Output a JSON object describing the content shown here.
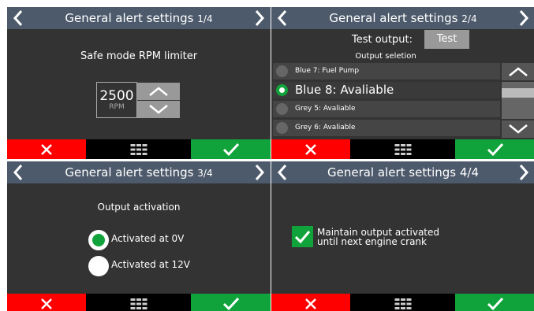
{
  "colors": {
    "background": "#333333",
    "title_bar": "#4d5a6b",
    "cancel": "#ff0000",
    "confirm": "#11a33b",
    "control_gray": "#999999"
  },
  "screens": [
    {
      "title": "General alert settings",
      "page": "1/4",
      "label": "Safe mode RPM limiter",
      "rpm_value": "2500",
      "rpm_unit": "RPM"
    },
    {
      "title": "General alert settings",
      "page": "2/4",
      "test_label": "Test output:",
      "test_button": "Test",
      "list_header": "Output seletion",
      "outputs": [
        {
          "label": "Blue 7: Fuel Pump",
          "selected": false
        },
        {
          "label": "Blue 8: Avaliable",
          "selected": true
        },
        {
          "label": "Grey 5: Avaliable",
          "selected": false
        },
        {
          "label": "Grey 6: Avaliable",
          "selected": false
        }
      ]
    },
    {
      "title": "General alert settings",
      "page": "3/4",
      "label": "Output activation",
      "options": [
        {
          "label": "Activated at 0V",
          "checked": true
        },
        {
          "label": "Activated at 12V",
          "checked": false
        }
      ]
    },
    {
      "title": "General alert settings 4/4",
      "checkbox_checked": true,
      "checkbox_line1": "Maintain output activated",
      "checkbox_line2": "until next engine crank"
    }
  ],
  "icons": {
    "nav_prev": "chevron-left-icon",
    "nav_next": "chevron-right-icon",
    "cancel": "close-icon",
    "menu": "grid-icon",
    "confirm": "check-icon",
    "increase": "chevron-up-icon",
    "decrease": "chevron-down-icon"
  }
}
